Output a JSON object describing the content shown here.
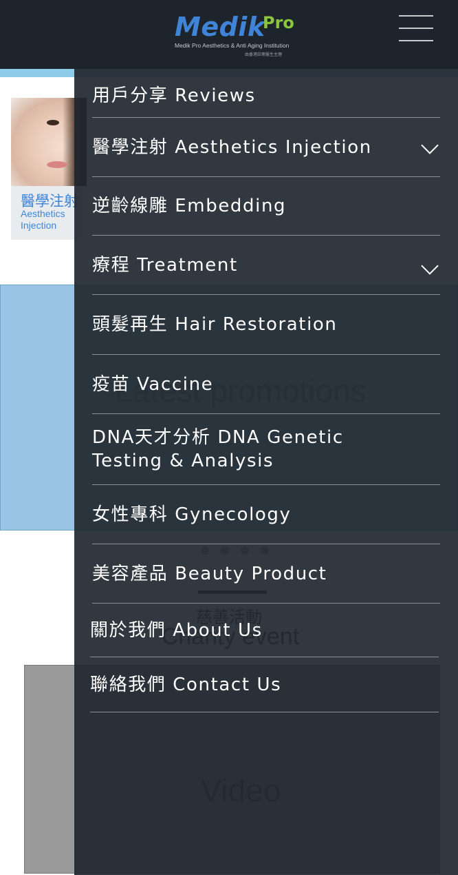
{
  "header": {
    "logo_medik": "Medik",
    "logo_pro": "Pro",
    "logo_tagline": "Medik Pro Aesthetics & Anti Aging Institution",
    "logo_tagline_zh": "由香港註冊醫生主理"
  },
  "background": {
    "service_card": {
      "title": "醫學注射",
      "subtitle": "Aesthetics Injection"
    },
    "promotions_title": "Latest promotions",
    "charity_title_zh": "慈善活動",
    "charity_title_en": "Charity event",
    "video_label": "Video"
  },
  "menu": {
    "items": [
      {
        "label": "用戶分享 Reviews",
        "has_submenu": false
      },
      {
        "label": "醫學注射 Aesthetics Injection",
        "has_submenu": true
      },
      {
        "label": "逆齡線雕 Embedding",
        "has_submenu": false
      },
      {
        "label": "療程 Treatment",
        "has_submenu": true
      },
      {
        "label": "頭髮再生 Hair Restoration",
        "has_submenu": false
      },
      {
        "label": "疫苗 Vaccine",
        "has_submenu": false
      },
      {
        "label": "DNA天才分析 DNA Genetic\nTesting & Analysis",
        "has_submenu": false
      },
      {
        "label": "女性專科 Gynecology",
        "has_submenu": false
      },
      {
        "label": "美容產品 Beauty Product",
        "has_submenu": false
      },
      {
        "label": "關於我們 About Us",
        "has_submenu": false
      },
      {
        "label": "聯絡我們 Contact Us",
        "has_submenu": false
      }
    ]
  },
  "colors": {
    "header_bg": "#1d242c",
    "menu_bg": "#21272f",
    "brand_blue": "#3f84d6",
    "brand_green": "#8cc63f",
    "panel_blue": "#99c4e3"
  },
  "icons": {
    "menu_toggle": "hamburger-icon",
    "submenu": "chevron-down-icon"
  }
}
